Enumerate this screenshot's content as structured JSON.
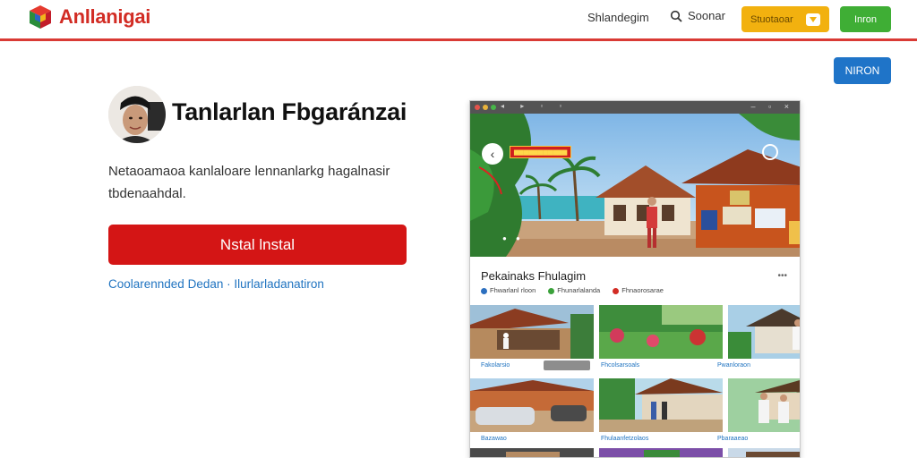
{
  "header": {
    "logo_text": "Anllanigai",
    "nav_link": "Shlandegim",
    "search_label": "Soonar",
    "yellow_button": "Stuotaoar",
    "green_button": "Inron",
    "blue_button": "NIRON"
  },
  "main": {
    "title": "Tanlarlan Fbgaránzai",
    "description": "Netaoamaoa kanlaloare lennanlarkg hagalnasir tbdenaahdal.",
    "install_button": "Nstal lnstal",
    "sub_link": "Coolarennded Dedan · Ilurlarladanatiron"
  },
  "app_window": {
    "hero_banner": "▆▆▆▆▆▆▆▆▆▆▆",
    "gallery_title": "Pekainaks Fhulagim",
    "meta": [
      "Fhwarlanl rloon",
      "Fhunarlalanda",
      "Fhnaorosarae"
    ],
    "captions": [
      "Fakolarsio",
      "Fhcolsarsoals",
      "Pwanloraon",
      "Bazawao",
      "Fhulaanfetzolaos",
      "Pbaraaeao"
    ]
  },
  "colors": {
    "accent_red": "#d41515",
    "header_line": "#d93a35",
    "yellow": "#f2b10f",
    "green": "#3fae35",
    "blue": "#1f74c8",
    "link_blue": "#1f73c0"
  },
  "icons": [
    "logo-cube-icon",
    "search-icon",
    "shield-icon",
    "back-arrow-icon",
    "menu-dots-icon"
  ]
}
